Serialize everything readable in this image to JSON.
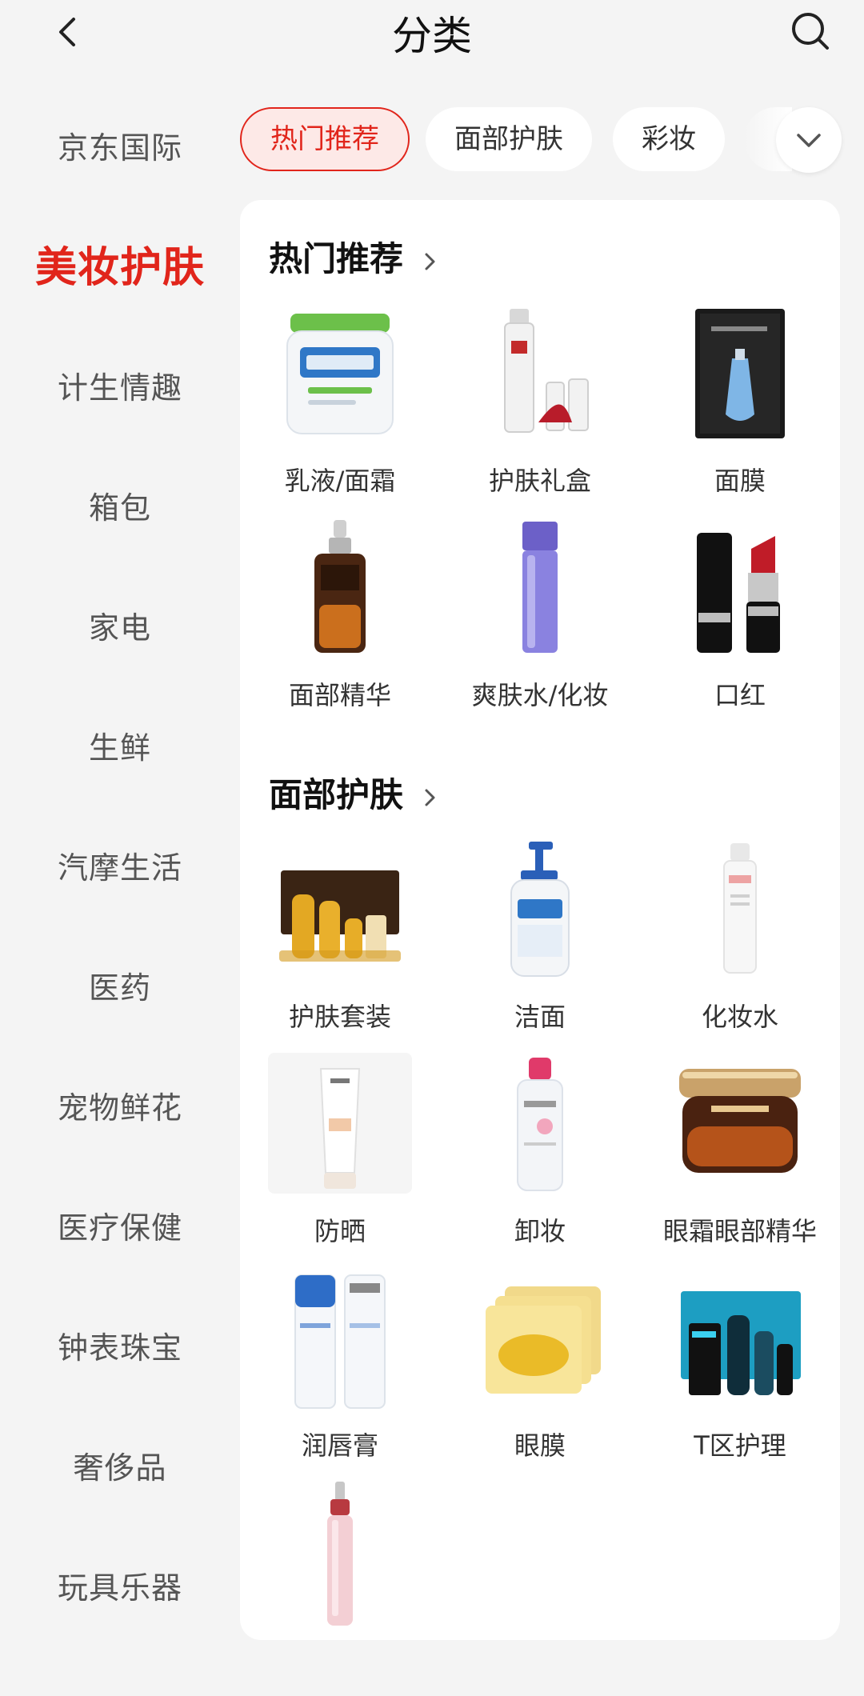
{
  "header": {
    "title": "分类"
  },
  "sidebar": {
    "items": [
      {
        "label": "京东国际"
      },
      {
        "label": "美妆护肤",
        "active": true
      },
      {
        "label": "计生情趣"
      },
      {
        "label": "箱包"
      },
      {
        "label": "家电"
      },
      {
        "label": "生鲜"
      },
      {
        "label": "汽摩生活"
      },
      {
        "label": "医药"
      },
      {
        "label": "宠物鲜花"
      },
      {
        "label": "医疗保健"
      },
      {
        "label": "钟表珠宝"
      },
      {
        "label": "奢侈品"
      },
      {
        "label": "玩具乐器"
      }
    ]
  },
  "tabs": [
    {
      "label": "热门推荐",
      "active": true
    },
    {
      "label": "面部护肤"
    },
    {
      "label": "彩妆"
    }
  ],
  "sections": [
    {
      "title": "热门推荐",
      "items": [
        {
          "label": "乳液/面霜",
          "icon": "cream-jar-icon"
        },
        {
          "label": "护肤礼盒",
          "icon": "gift-set-icon"
        },
        {
          "label": "面膜",
          "icon": "mask-pack-icon"
        },
        {
          "label": "面部精华",
          "icon": "serum-bottle-icon"
        },
        {
          "label": "爽肤水/化妆",
          "icon": "toner-bottle-icon"
        },
        {
          "label": "口红",
          "icon": "lipstick-icon"
        }
      ]
    },
    {
      "title": "面部护肤",
      "items": [
        {
          "label": "护肤套装",
          "icon": "skincare-set-icon"
        },
        {
          "label": "洁面",
          "icon": "cleanser-pump-icon"
        },
        {
          "label": "化妆水",
          "icon": "lotion-bottle-icon"
        },
        {
          "label": "防晒",
          "icon": "sunscreen-tube-icon"
        },
        {
          "label": "卸妆",
          "icon": "makeup-remover-icon"
        },
        {
          "label": "眼霜眼部精华",
          "icon": "eye-cream-jar-icon"
        },
        {
          "label": "润唇膏",
          "icon": "lip-balm-icon"
        },
        {
          "label": "眼膜",
          "icon": "eye-mask-icon"
        },
        {
          "label": "T区护理",
          "icon": "t-zone-kit-icon"
        },
        {
          "label": "",
          "icon": "eye-serum-icon"
        }
      ]
    }
  ],
  "colors": {
    "accent": "#e1251b",
    "background": "#f4f4f4",
    "panel": "#ffffff"
  }
}
